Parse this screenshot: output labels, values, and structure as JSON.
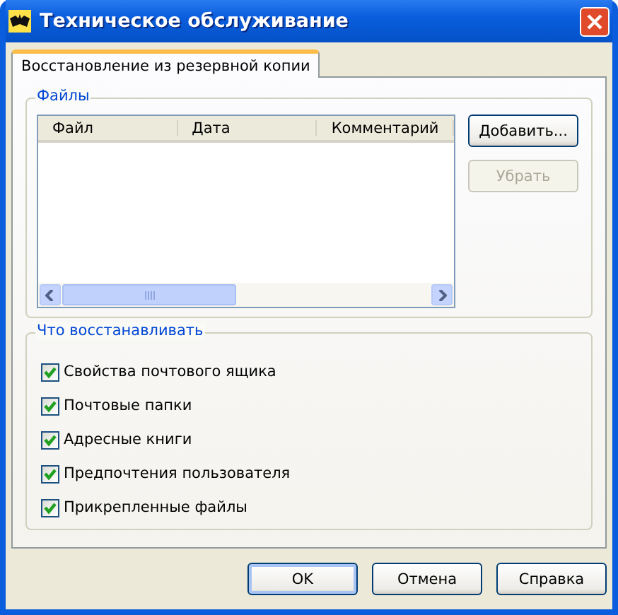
{
  "window": {
    "title": "Техническое обслуживание"
  },
  "tabs": [
    {
      "label": "Восстановление из резервной копии",
      "selected": true
    }
  ],
  "files_group": {
    "title": "Файлы",
    "table": {
      "columns": [
        "Файл",
        "Дата",
        "Комментарий"
      ]
    },
    "buttons": [
      {
        "label": "Добавить...",
        "disabled": false
      },
      {
        "label": "Убрать",
        "disabled": true
      }
    ]
  },
  "restore_group": {
    "title": "Что восстанавливать",
    "options": [
      {
        "label": "Свойства почтового ящика",
        "checked": true
      },
      {
        "label": "Почтовые папки",
        "checked": true
      },
      {
        "label": "Адресные книги",
        "checked": true
      },
      {
        "label": "Предпочтения пользователя",
        "checked": true
      },
      {
        "label": "Прикрепленные файлы",
        "checked": true
      }
    ]
  },
  "buttons": [
    {
      "label": "OK",
      "default": true
    },
    {
      "label": "Отмена",
      "default": false
    },
    {
      "label": "Справка",
      "default": false
    }
  ]
}
